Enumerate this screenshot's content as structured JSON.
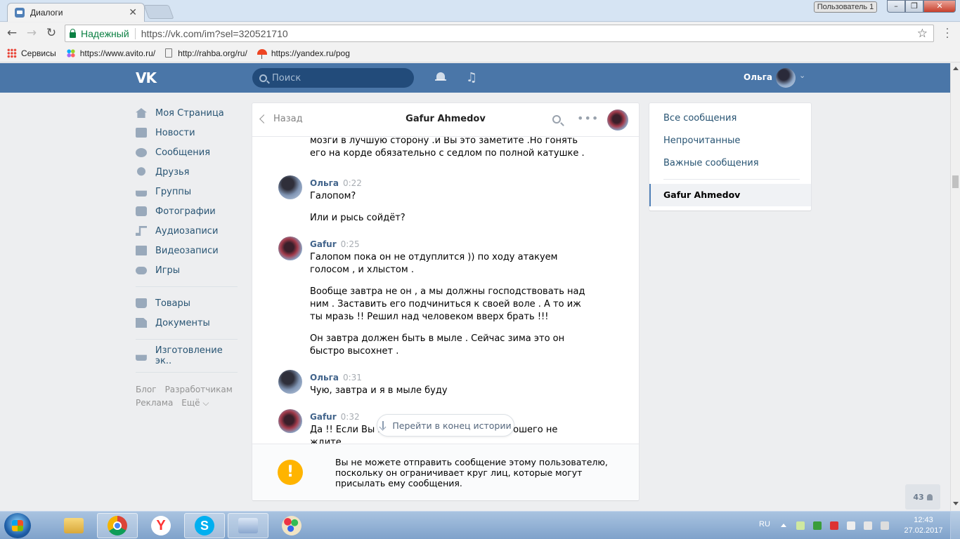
{
  "browser": {
    "tab_title": "Диалоги",
    "profile_label": "Пользователь 1",
    "secure_label": "Надежный",
    "url": "https://vk.com/im?sel=320521710",
    "bookmarks": [
      {
        "label": "Сервисы",
        "icon": "apps-icon"
      },
      {
        "label": "https://www.avito.ru/",
        "icon": "avito-icon"
      },
      {
        "label": "http://rahba.org/ru/",
        "icon": "page-icon"
      },
      {
        "label": "https://yandex.ru/pog",
        "icon": "yandex-icon"
      }
    ]
  },
  "vk_header": {
    "logo": "VK",
    "search_placeholder": "Поиск",
    "user_name": "Ольга"
  },
  "left_nav": {
    "items": [
      {
        "label": "Моя Страница",
        "icon": "home-icon"
      },
      {
        "label": "Новости",
        "icon": "news-icon"
      },
      {
        "label": "Сообщения",
        "icon": "messages-icon"
      },
      {
        "label": "Друзья",
        "icon": "friends-icon"
      },
      {
        "label": "Группы",
        "icon": "groups-icon"
      },
      {
        "label": "Фотографии",
        "icon": "photos-icon"
      },
      {
        "label": "Аудиозаписи",
        "icon": "audio-icon"
      },
      {
        "label": "Видеозаписи",
        "icon": "video-icon"
      },
      {
        "label": "Игры",
        "icon": "games-icon"
      }
    ],
    "items2": [
      {
        "label": "Товары",
        "icon": "goods-icon"
      },
      {
        "label": "Документы",
        "icon": "documents-icon"
      }
    ],
    "items3": [
      {
        "label": "Изготовление эк..",
        "icon": "community-icon"
      }
    ],
    "footer": {
      "blog": "Блог",
      "developers": "Разработчикам",
      "ads": "Реклама",
      "more": "Ещё ⌵"
    }
  },
  "dialog": {
    "back_label": "Назад",
    "title": "Gafur Ahmedov",
    "continuation": "мозги в лучшую сторону .и Вы это заметите .Но гонять его на корде обязательно с седлом по полной катушке .",
    "messages": [
      {
        "author": "Ольга",
        "time": "0:22",
        "texts": [
          "Галопом?",
          "Или и рысь сойдёт?"
        ]
      },
      {
        "author": "Gafur",
        "time": "0:25",
        "texts": [
          "Галопом пока он не отдуплится )) по ходу атакуем голосом , и хлыстом .",
          "Вообще завтра не он , а мы должны господствовать над ним . Заставить его подчиниться к своей воле . А то иж ты мразь !! Решил над человеком вверх брать !!!",
          "Он завтра должен быть в мыле . Сейчас зима это он быстро высохнет ."
        ]
      },
      {
        "author": "Ольга",
        "time": "0:31",
        "texts": [
          "Чую, завтра и я в мыле буду"
        ]
      },
      {
        "author": "Gafur",
        "time": "0:32",
        "texts": [
          "Да !! Если Вы не на место , то от него хорошего не ждите ."
        ]
      }
    ],
    "jump_label": "Перейти в конец истории",
    "blocked_text": "Вы не можете отправить сообщение этому пользователю, поскольку он ограничивает круг лиц, которые могут присылать ему сообщения."
  },
  "right_menu": {
    "all": "Все сообщения",
    "unread": "Непрочитанные",
    "important": "Важные сообщения",
    "active_dialog": "Gafur Ahmedov"
  },
  "online_count": "43",
  "taskbar": {
    "lang": "RU",
    "time": "12:43",
    "date": "27.02.2017"
  }
}
